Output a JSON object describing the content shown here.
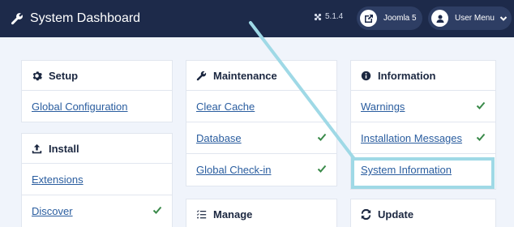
{
  "header": {
    "title": "System Dashboard",
    "version": "5.1.4",
    "joomla_label": "Joomla 5",
    "user_menu_label": "User Menu"
  },
  "cards": {
    "setup": {
      "title": "Setup",
      "items": [
        "Global Configuration"
      ]
    },
    "install": {
      "title": "Install",
      "items": [
        "Extensions",
        "Discover"
      ]
    },
    "maintenance": {
      "title": "Maintenance",
      "items": [
        "Clear Cache",
        "Database",
        "Global Check-in"
      ]
    },
    "manage": {
      "title": "Manage"
    },
    "information": {
      "title": "Information",
      "items": [
        "Warnings",
        "Installation Messages",
        "System Information"
      ]
    },
    "update": {
      "title": "Update"
    }
  },
  "colors": {
    "header_bg": "#1d2a4a",
    "link": "#2a5d9f",
    "check": "#3a8a4a",
    "highlight": "#9fd9e6"
  }
}
